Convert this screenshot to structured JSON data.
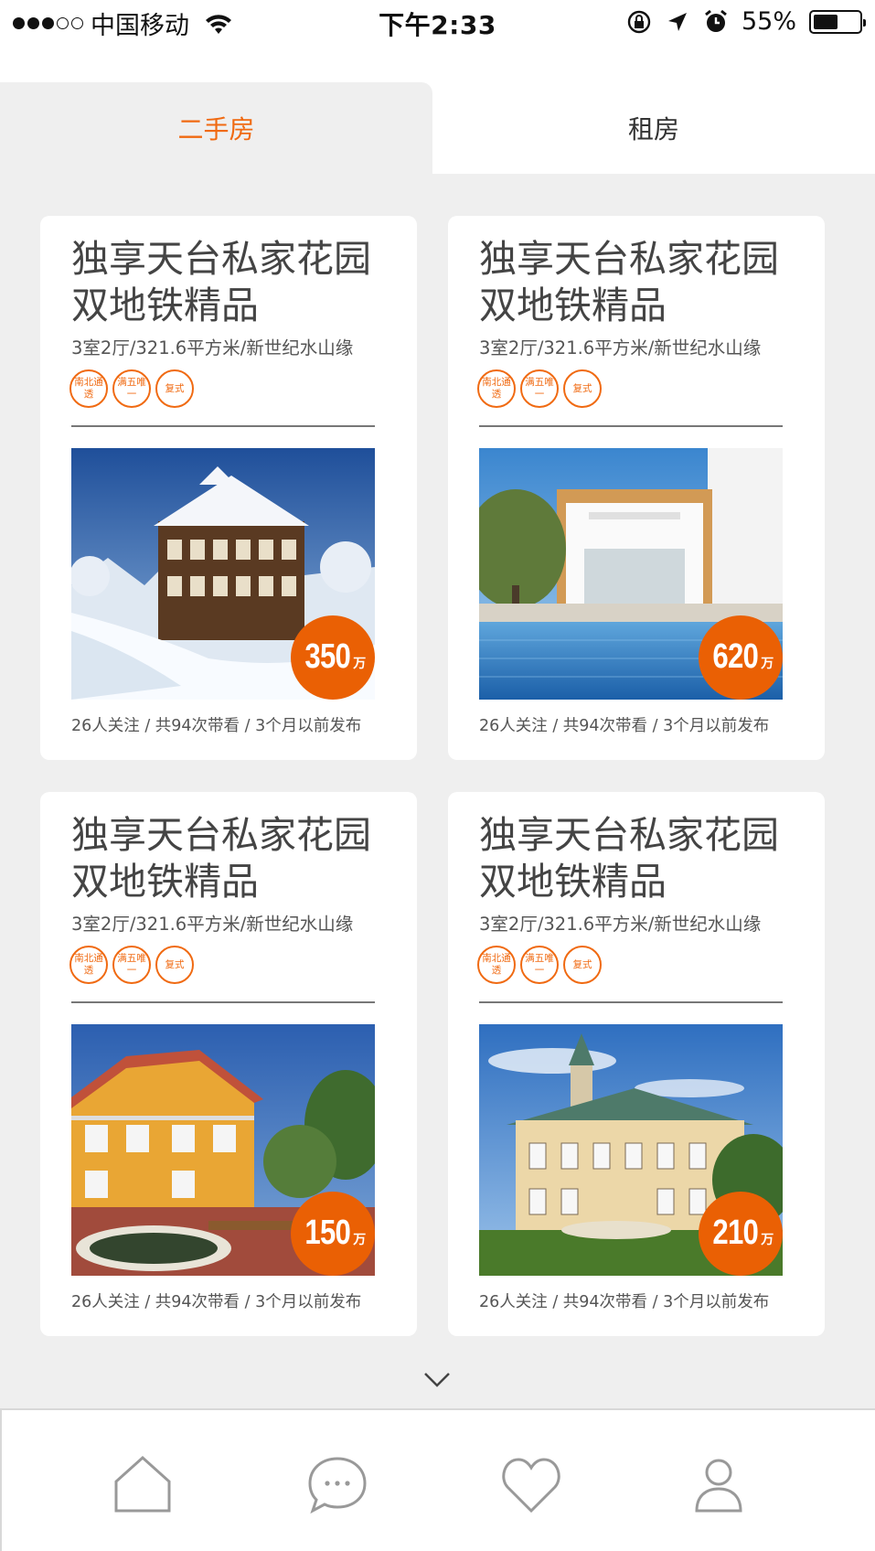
{
  "status_bar": {
    "carrier": "中国移动",
    "time": "下午2:33",
    "battery_pct": "55%",
    "battery_level": 0.55,
    "icons": [
      "signal-dots",
      "wifi-icon",
      "orientation-lock-icon",
      "location-arrow-icon",
      "alarm-icon",
      "battery-icon"
    ]
  },
  "tabs": [
    {
      "label": "二手房",
      "active": true
    },
    {
      "label": "租房",
      "active": false
    }
  ],
  "colors": {
    "accent": "#f06a12",
    "price_badge": "#ea6004",
    "background": "#efefef"
  },
  "listings": [
    {
      "title": "独享天台私家花园双地铁精品",
      "subtitle": "3室2厅/321.6平方米/新世纪水山缘",
      "tags": [
        "南北通透",
        "满五唯一",
        "复式"
      ],
      "price": "350",
      "price_unit": "万",
      "meta": "26人关注 / 共94次带看 / 3个月以前发布",
      "photo": "snowy-timber-villa"
    },
    {
      "title": "独享天台私家花园双地铁精品",
      "subtitle": "3室2厅/321.6平方米/新世纪水山缘",
      "tags": [
        "南北通透",
        "满五唯一",
        "复式"
      ],
      "price": "620",
      "price_unit": "万",
      "meta": "26人关注 / 共94次带看 / 3个月以前发布",
      "photo": "modern-villa-pool"
    },
    {
      "title": "独享天台私家花园双地铁精品",
      "subtitle": "3室2厅/321.6平方米/新世纪水山缘",
      "tags": [
        "南北通透",
        "满五唯一",
        "复式"
      ],
      "price": "150",
      "price_unit": "万",
      "meta": "26人关注 / 共94次带看 / 3个月以前发布",
      "photo": "yellow-house-pond"
    },
    {
      "title": "独享天台私家花园双地铁精品",
      "subtitle": "3室2厅/321.6平方米/新世纪水山缘",
      "tags": [
        "南北通透",
        "满五唯一",
        "复式"
      ],
      "price": "210",
      "price_unit": "万",
      "meta": "26人关注 / 共94次带看 / 3个月以前发布",
      "photo": "manor-tower-house"
    }
  ],
  "bottom_nav": [
    "home-icon",
    "chat-icon",
    "heart-icon",
    "profile-icon"
  ]
}
